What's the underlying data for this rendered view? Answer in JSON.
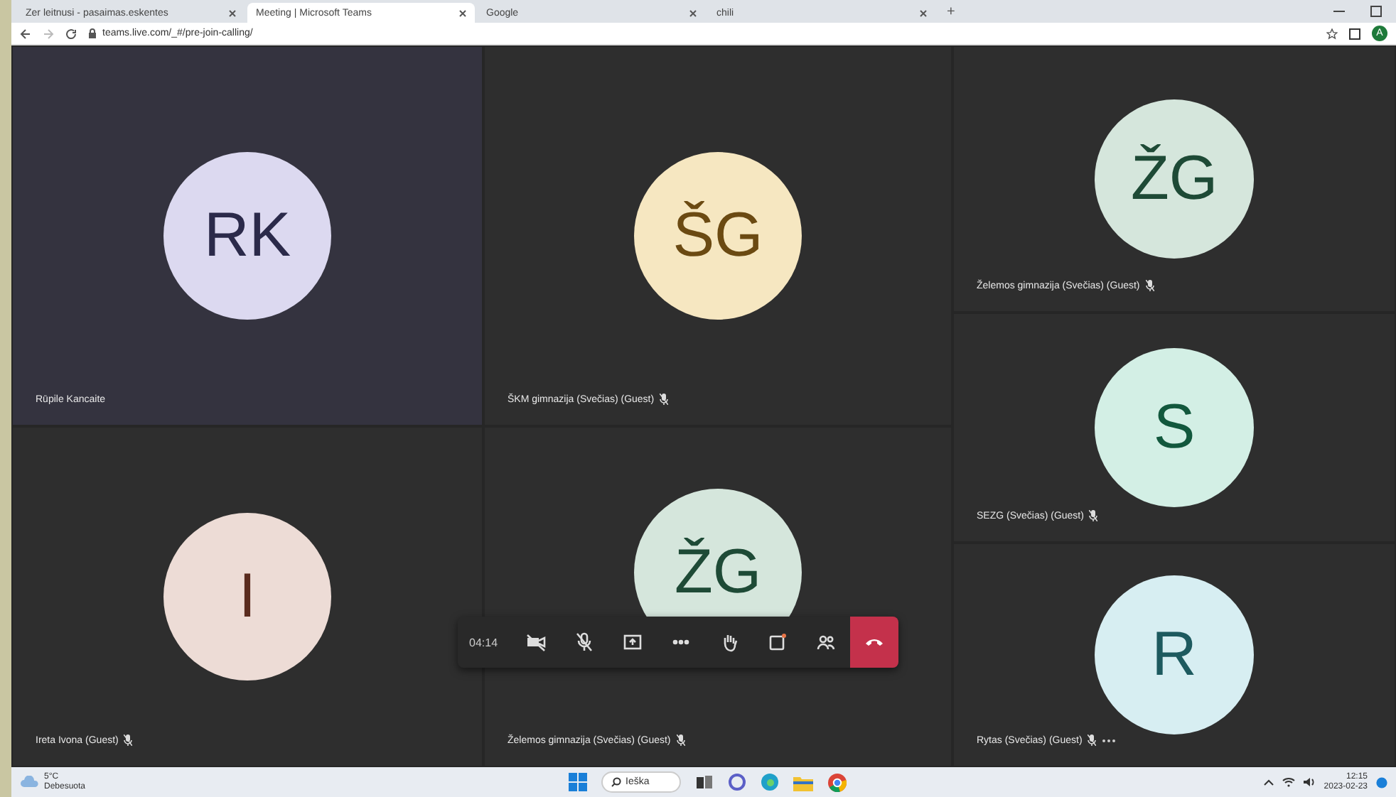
{
  "browser": {
    "tabs": [
      {
        "title": "Zer leitnusi - pasaimas.eskentes",
        "selected": false
      },
      {
        "title": "Meeting | Microsoft Teams",
        "selected": true
      },
      {
        "title": "Google",
        "selected": false
      },
      {
        "title": "chili",
        "selected": false
      }
    ],
    "new_tab": "+",
    "address": "teams.live.com/_#/pre-join-calling/",
    "profile": "A"
  },
  "tiles": [
    {
      "initials": "RK",
      "name": "Rūpile Kancaite",
      "color": "#dcd9f0",
      "muted": false,
      "menu": false
    },
    {
      "initials": "I",
      "name": "Ireta Ivona (Guest)",
      "color": "#eddcd6",
      "muted": true,
      "menu": false
    },
    {
      "initials": "ŠG",
      "name": "ŠKM gimnazija (Svečias) (Guest)",
      "color": "#f6e7c1",
      "muted": true,
      "menu": false
    },
    {
      "initials": "ŽG",
      "name": "Želemos gimnazija (Svečias) (Guest)",
      "color": "#d5e6dc",
      "muted": true,
      "menu": false
    },
    {
      "initials": "ŽG",
      "name": "Želemos gimnazija (Svečias) (Guest)",
      "color": "#d5e6dc",
      "muted": true,
      "menu": false
    },
    {
      "initials": "S",
      "name": "SEZG (Svečias) (Guest)",
      "color": "#d3efe5",
      "muted": true,
      "menu": false
    },
    {
      "initials": "R",
      "name": "Rytas (Svečias) (Guest)",
      "color": "#d7eef2",
      "muted": true,
      "menu": true
    }
  ],
  "call_bar": {
    "timer": "04:14"
  },
  "taskbar": {
    "temperature": "5°C",
    "weather": "Debesuota",
    "search": "Ieška",
    "time": "12:15",
    "date": "2023-02-23"
  }
}
